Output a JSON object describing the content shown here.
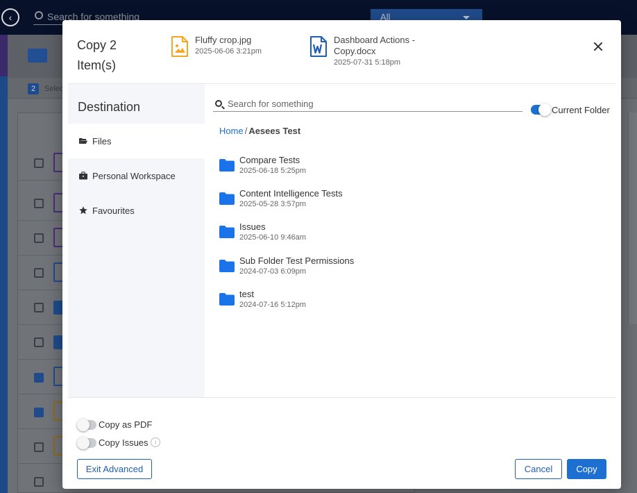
{
  "background": {
    "search_placeholder": "Search for something",
    "filter_value": "All",
    "selection_count": "2",
    "selection_text": "Selec"
  },
  "dialog": {
    "title": "Copy 2 Item(s)",
    "files": [
      {
        "name": "Fluffy crop.jpg",
        "date": "2025-06-06 3:21pm",
        "icon": "image-file-icon"
      },
      {
        "name": "Dashboard Actions - Copy.docx",
        "date": "2025-07-31 5:18pm",
        "icon": "word-file-icon"
      }
    ],
    "destination": {
      "title": "Destination",
      "items": [
        {
          "label": "Files",
          "icon": "folder-open-icon",
          "active": true
        },
        {
          "label": "Personal Workspace",
          "icon": "briefcase-icon",
          "active": false
        },
        {
          "label": "Favourites",
          "icon": "star-icon",
          "active": false
        }
      ]
    },
    "search": {
      "placeholder": "Search for something"
    },
    "current_folder": {
      "label": "Current Folder",
      "enabled": true
    },
    "breadcrumb": {
      "home": "Home",
      "separator": "/",
      "current": "Aesees Test"
    },
    "folders": [
      {
        "name": "Compare Tests",
        "date": "2025-06-18 5:25pm"
      },
      {
        "name": "Content Intelligence Tests",
        "date": "2025-05-28 3:57pm"
      },
      {
        "name": "Issues",
        "date": "2025-06-10 9:46am"
      },
      {
        "name": "Sub Folder Test Permissions",
        "date": "2024-07-03 6:09pm"
      },
      {
        "name": "test",
        "date": "2024-07-16 5:12pm"
      }
    ],
    "options": {
      "copy_as_pdf": {
        "label": "Copy as PDF",
        "enabled": false
      },
      "copy_issues": {
        "label": "Copy Issues",
        "enabled": false
      }
    },
    "buttons": {
      "exit_advanced": "Exit Advanced",
      "cancel": "Cancel",
      "copy": "Copy"
    }
  },
  "colors": {
    "accent": "#1d6fd1",
    "folder": "#1a73e8",
    "image_icon": "#f5a623",
    "word_icon": "#1a5fb4",
    "sidebar_bg": "#f4f6f9"
  }
}
